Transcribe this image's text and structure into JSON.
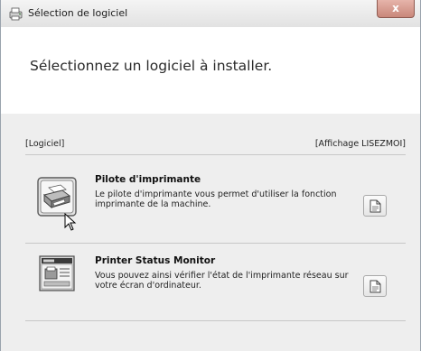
{
  "window": {
    "title": "Sélection de logiciel",
    "close_label": "x"
  },
  "header": {
    "headline": "Sélectionnez un logiciel à installer."
  },
  "content": {
    "left_label": "[Logiciel]",
    "right_label": "[Affichage LISEZMOI]",
    "entries": [
      {
        "title": "Pilote d'imprimante",
        "description": "Le pilote d'imprimante vous permet d'utiliser la fonction imprimante de la machine.",
        "icon": "printer-icon"
      },
      {
        "title": "Printer Status Monitor",
        "description": "Vous pouvez ainsi vérifier l'état de l'imprimante réseau sur votre écran d'ordinateur.",
        "icon": "status-monitor-icon"
      }
    ]
  },
  "colors": {
    "window_bg": "#eeeeee",
    "header_bg": "#ffffff",
    "close_button": "#c9877a"
  }
}
